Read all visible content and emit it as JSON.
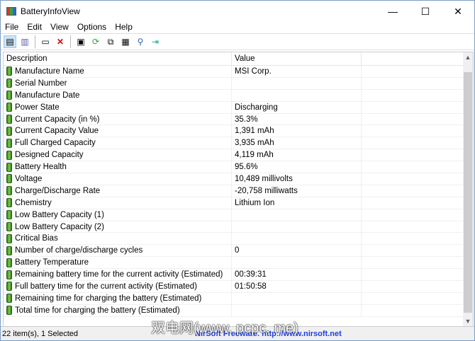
{
  "window": {
    "title": "BatteryInfoView",
    "minimize": "—",
    "maximize": "☐",
    "close": "✕"
  },
  "menu": [
    "File",
    "Edit",
    "View",
    "Options",
    "Help"
  ],
  "toolbar": [
    "properties-icon",
    "clipboard-icon",
    "html-report-icon",
    "delete-icon",
    "save-icon",
    "refresh-icon",
    "copy-icon",
    "options-icon",
    "find-icon",
    "exit-icon"
  ],
  "columns": {
    "description": "Description",
    "value": "Value"
  },
  "rows": [
    {
      "d": "Manufacture Name",
      "v": "MSI Corp."
    },
    {
      "d": "Serial Number",
      "v": ""
    },
    {
      "d": "Manufacture Date",
      "v": ""
    },
    {
      "d": "Power State",
      "v": "Discharging"
    },
    {
      "d": "Current Capacity (in %)",
      "v": "35.3%"
    },
    {
      "d": "Current Capacity Value",
      "v": "1,391 mAh"
    },
    {
      "d": "Full Charged Capacity",
      "v": "3,935 mAh"
    },
    {
      "d": "Designed Capacity",
      "v": "4,119 mAh"
    },
    {
      "d": "Battery Health",
      "v": "95.6%"
    },
    {
      "d": "Voltage",
      "v": "10,489 millivolts"
    },
    {
      "d": "Charge/Discharge Rate",
      "v": "-20,758 milliwatts"
    },
    {
      "d": "Chemistry",
      "v": "Lithium Ion"
    },
    {
      "d": "Low Battery Capacity (1)",
      "v": ""
    },
    {
      "d": "Low Battery Capacity (2)",
      "v": ""
    },
    {
      "d": "Critical Bias",
      "v": ""
    },
    {
      "d": "Number of charge/discharge cycles",
      "v": "0"
    },
    {
      "d": "Battery Temperature",
      "v": ""
    },
    {
      "d": "Remaining battery time for the current activity (Estimated)",
      "v": "00:39:31"
    },
    {
      "d": "Full battery time for the current activity (Estimated)",
      "v": "01:50:58"
    },
    {
      "d": "Remaining time for charging the battery (Estimated)",
      "v": ""
    },
    {
      "d": "Total  time for charging the battery (Estimated)",
      "v": ""
    }
  ],
  "status": {
    "count": "22 item(s), 1 Selected",
    "credit": "NirSoft Freeware.  http://www.nirsoft.net"
  },
  "watermark": "双电网(www. pcpc. me)"
}
